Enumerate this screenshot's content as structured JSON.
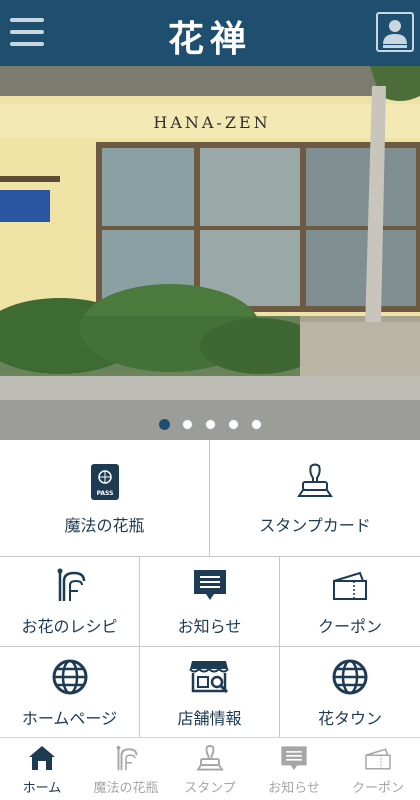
{
  "header": {
    "logo_text": "花禅"
  },
  "hero": {
    "sign_text": "HANA-ZEN",
    "slide_count": 5,
    "active_slide": 1
  },
  "menu": {
    "tiles": [
      {
        "label": "魔法の花瓶",
        "icon": "passport-icon"
      },
      {
        "label": "スタンプカード",
        "icon": "stamp-icon"
      },
      {
        "label": "お花のレシピ",
        "icon": "flower-recipe-icon"
      },
      {
        "label": "お知らせ",
        "icon": "message-icon"
      },
      {
        "label": "クーポン",
        "icon": "coupon-icon"
      },
      {
        "label": "ホームページ",
        "icon": "globe-icon"
      },
      {
        "label": "店舗情報",
        "icon": "shop-icon"
      },
      {
        "label": "花タウン",
        "icon": "globe-icon"
      }
    ],
    "passport_text": "PASS"
  },
  "tabbar": {
    "tabs": [
      {
        "label": "ホーム",
        "icon": "home-icon",
        "active": true
      },
      {
        "label": "魔法の花瓶",
        "icon": "flower-recipe-icon",
        "active": false
      },
      {
        "label": "スタンプ",
        "icon": "stamp-icon",
        "active": false
      },
      {
        "label": "お知らせ",
        "icon": "message-icon",
        "active": false
      },
      {
        "label": "クーポン",
        "icon": "coupon-icon",
        "active": false
      }
    ]
  },
  "colors": {
    "brand": "#1e4f6e",
    "icon": "#1d3b52",
    "inactive": "#a6a6a6"
  }
}
